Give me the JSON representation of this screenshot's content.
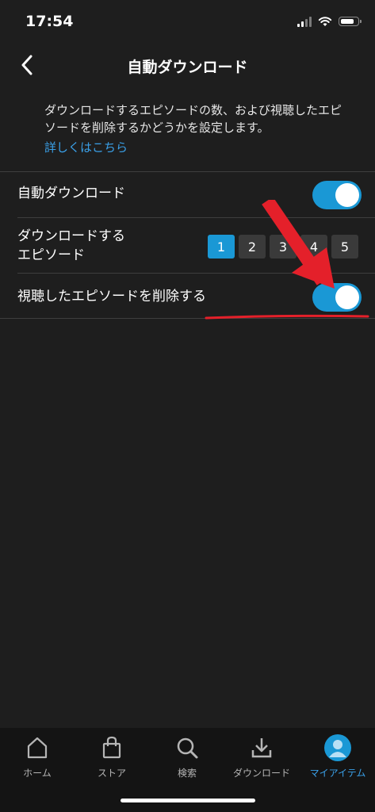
{
  "status_bar": {
    "time": "17:54"
  },
  "header": {
    "title": "自動ダウンロード"
  },
  "description": {
    "text": "ダウンロードするエピソードの数、および視聴したエピソードを削除するかどうかを設定します。",
    "link": "詳しくはこちら"
  },
  "settings": {
    "auto_download": {
      "label": "自動ダウンロード",
      "enabled": true
    },
    "episodes": {
      "label_line1": "ダウンロードする",
      "label_line2": "エピソード",
      "options": [
        "1",
        "2",
        "3",
        "4",
        "5"
      ],
      "selected": "1"
    },
    "delete_watched": {
      "label": "視聴したエピソードを削除する",
      "enabled": true
    }
  },
  "annotation": {
    "color": "#e4202a"
  },
  "tabs": [
    {
      "label": "ホーム",
      "icon": "home-icon"
    },
    {
      "label": "ストア",
      "icon": "store-bag-icon"
    },
    {
      "label": "検索",
      "icon": "search-icon"
    },
    {
      "label": "ダウンロード",
      "icon": "download-icon"
    },
    {
      "label": "マイアイテム",
      "icon": "avatar-icon",
      "active": true
    }
  ],
  "colors": {
    "accent": "#1a98d5",
    "link": "#3aa0e8",
    "background": "#1e1e1e",
    "tab_bar": "#141414"
  }
}
